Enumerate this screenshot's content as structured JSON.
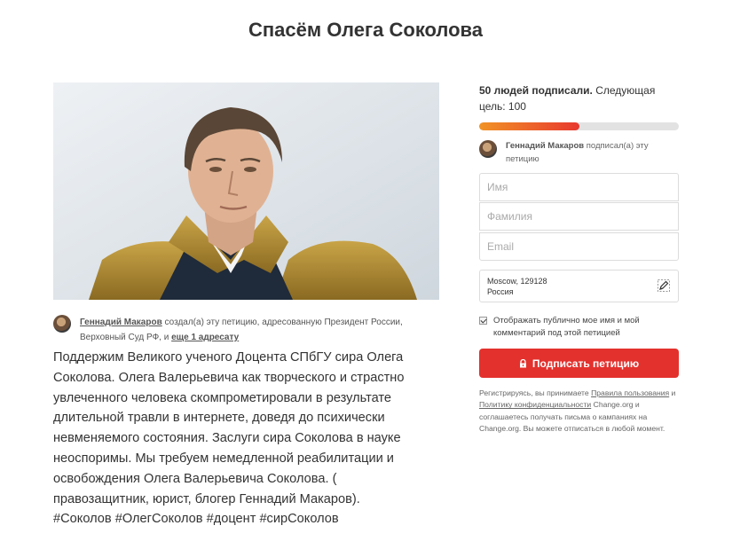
{
  "page": {
    "title": "Спасём Олега Соколова"
  },
  "photo": {
    "alt": "Олег Соколов"
  },
  "author": {
    "name": "Геннадий Макаров",
    "text_after_name": " создал(а) эту петицию, адресованную Президент России, Верховный Суд РФ, и ",
    "more_link": "еще 1 адресату"
  },
  "description": {
    "lines": [
      "Поддержим Великого ученого Доцента СПбГУ  сира Олега",
      "Соколова.  Олега Валерьевича как творческого и страстно",
      "увлеченного человека скомпрометировали в результате",
      "длительной травли в интернете, доведя до  психически",
      "невменяемого состояния.   Заслуги сира Соколова в науке",
      "неоспоримы.  Мы требуем немедленной реабилитации и",
      "освобождения Олега Валерьевича Соколова.  (",
      "правозащитник, юрист, блогер Геннадий Макаров).",
      "#Соколов #ОлегСоколов #доцент #сирСоколов"
    ]
  },
  "signatures": {
    "count_text": "50 людей подписали.",
    "goal_text": " Следующая цель: 100",
    "count": 50,
    "goal": 100,
    "progress_fraction": 0.5
  },
  "recent_signer": {
    "name": "Геннадий Макаров",
    "action": " подписал(а) эту петицию"
  },
  "form": {
    "first_name_placeholder": "Имя",
    "last_name_placeholder": "Фамилия",
    "email_placeholder": "Email",
    "location_line1": "Moscow, 129128",
    "location_line2": "Россия",
    "public_checkbox_label": "Отображать публично мое имя и мой комментарий под этой петицией",
    "public_checkbox_checked": true,
    "submit_label": "Подписать петицию"
  },
  "legal": {
    "part1": "Регистрируясь, вы принимаете ",
    "terms_link": "Правила пользования",
    "part2": " и ",
    "privacy_link": "Политику конфиденциальности",
    "part3": " Change.org и соглашаетесь получать письма о кампаниях на Change.org. Вы можете отписаться в любой момент."
  },
  "colors": {
    "accent_red": "#e3312d",
    "progress_start": "#f19326",
    "progress_end": "#e8382e"
  },
  "icons": {
    "edit": "pencil-icon",
    "lock": "lock-icon",
    "check": "checkmark-icon"
  }
}
